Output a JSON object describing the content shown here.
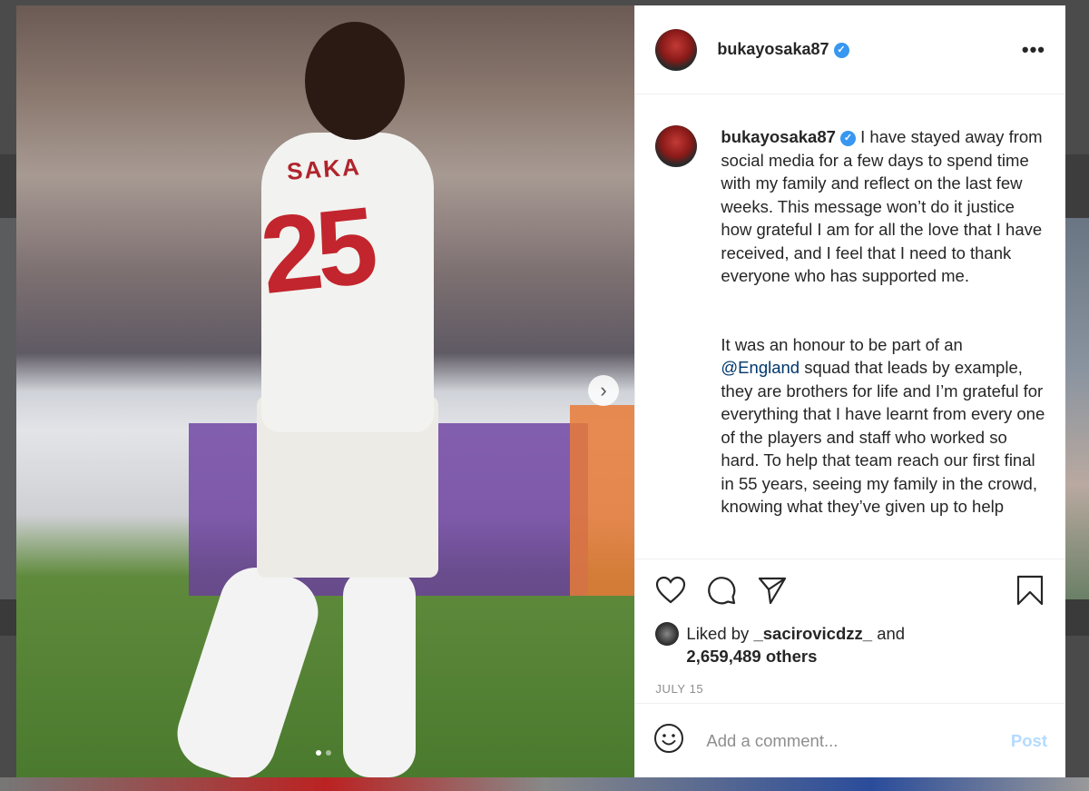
{
  "post": {
    "username": "bukayosaka87",
    "verified_icon": "verified-check-icon",
    "more_icon": "more-options-icon",
    "caption_paragraph_1": "I have stayed away from social media for a few days to spend time with my family and reflect on the last few weeks. This message won’t do it justice how grateful I am for all the love that I have received, and I feel that I need to thank everyone who has supported me.",
    "caption_paragraph_2_before": "It was an honour to be part of an ",
    "caption_mention": "@England",
    "caption_paragraph_2_after": " squad that leads by example, they are brothers for life and I’m grateful for everything that I have learnt from every one of the players and staff who worked so hard. To help that team reach our first final in 55 years, seeing my family in the crowd, knowing what they’ve given up to help",
    "liked_by_prefix": "Liked by ",
    "liked_by_user": "_sacirovicdzz_",
    "liked_by_middle": " and",
    "likes_count": "2,659,489 others",
    "date": "JULY 15"
  },
  "media": {
    "shirt_name": "SAKA",
    "shirt_number": "25",
    "carousel_total": 2,
    "carousel_index": 1
  },
  "actions": {
    "like_icon": "heart-icon",
    "comment_icon": "comment-icon",
    "share_icon": "share-icon",
    "save_icon": "bookmark-icon"
  },
  "comment": {
    "emoji_icon": "emoji-icon",
    "placeholder": "Add a comment...",
    "post_label": "Post"
  },
  "colors": {
    "accent_link": "#00376b",
    "verified": "#3897f0",
    "post_disabled": "#b3dbff"
  }
}
